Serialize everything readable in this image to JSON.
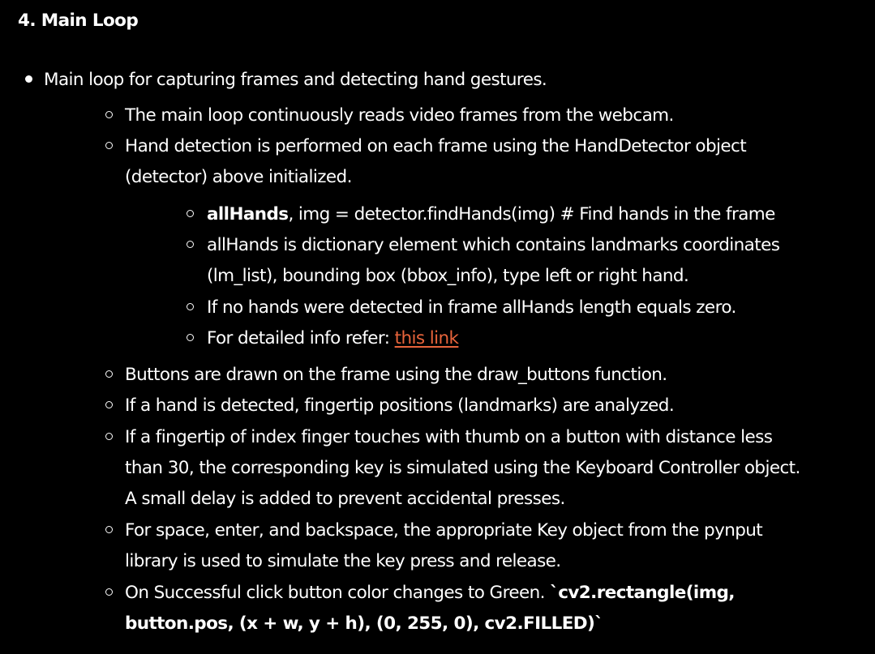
{
  "section": {
    "heading": "4. Main Loop"
  },
  "main_item": {
    "text": "Main loop for capturing frames and detecting hand gestures."
  },
  "sub_items": {
    "reads_frames": "The main loop continuously reads video frames from the webcam.",
    "hand_detection_line1": "Hand detection is performed on each frame using the HandDetector object",
    "hand_detection_line2": "(detector) above initialized.",
    "buttons_drawn": "Buttons are drawn on the frame using the draw_buttons function.",
    "fingertip_analyzed": "If a hand is detected, fingertip positions (landmarks) are analyzed.",
    "touch_line1": "If a fingertip of index finger touches with thumb on a button with distance less",
    "touch_line2": "than 30, the corresponding key is simulated using the Keyboard Controller object.",
    "touch_line3": "A small delay is added to prevent accidental presses.",
    "special_keys_line1": "For space, enter, and backspace, the appropriate Key object from the pynput",
    "special_keys_line2": "library is used to simulate the key press and release.",
    "success_text": "On Successful click button color changes to Green. ",
    "success_code_line1": "`cv2.rectangle(img,",
    "success_code_line2": "button.pos, (x + w, y + h), (0, 255, 0), cv2.FILLED)`"
  },
  "nested_items": {
    "allhands_bold": "allHands",
    "allhands_rest": ", img = detector.findHands(img) # Find hands in the frame",
    "dict_line1": "allHands is dictionary element which contains landmarks coordinates",
    "dict_line2": "(lm_list), bounding box (bbox_info), type left or right hand.",
    "no_hands": "If no hands were detected in frame allHands length equals zero.",
    "refer_prefix": "For detailed info refer: ",
    "refer_link": "this link"
  },
  "colors": {
    "background": "#000000",
    "text": "#ffffff",
    "link": "#e8643b"
  }
}
